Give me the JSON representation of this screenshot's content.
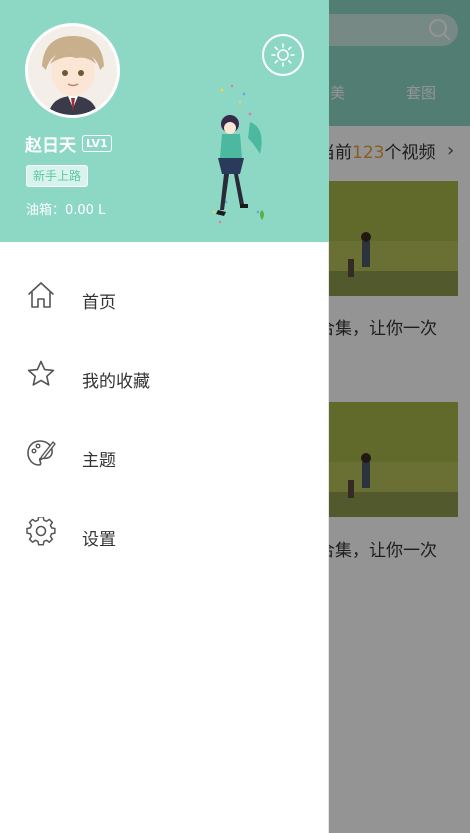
{
  "main": {
    "tabs": [
      "美",
      "套图"
    ],
    "video_count": {
      "prefix": "当前",
      "number": "123",
      "suffix": "个视频"
    },
    "cards": [
      {
        "title": "合集，让你一次"
      },
      {
        "title": "合集，让你一次"
      }
    ]
  },
  "drawer": {
    "user": {
      "name": "赵日天",
      "level": "LV1",
      "tag": "新手上路",
      "fuel": "油箱：0.00 L"
    },
    "menu": [
      {
        "label": "首页",
        "icon": "home-icon"
      },
      {
        "label": "我的收藏",
        "icon": "star-icon"
      },
      {
        "label": "主题",
        "icon": "palette-icon"
      },
      {
        "label": "设置",
        "icon": "gear-icon"
      }
    ]
  },
  "colors": {
    "accent": "#8dd8c4",
    "count_highlight": "#e8a23a",
    "tag_text": "#5cc7a8"
  }
}
